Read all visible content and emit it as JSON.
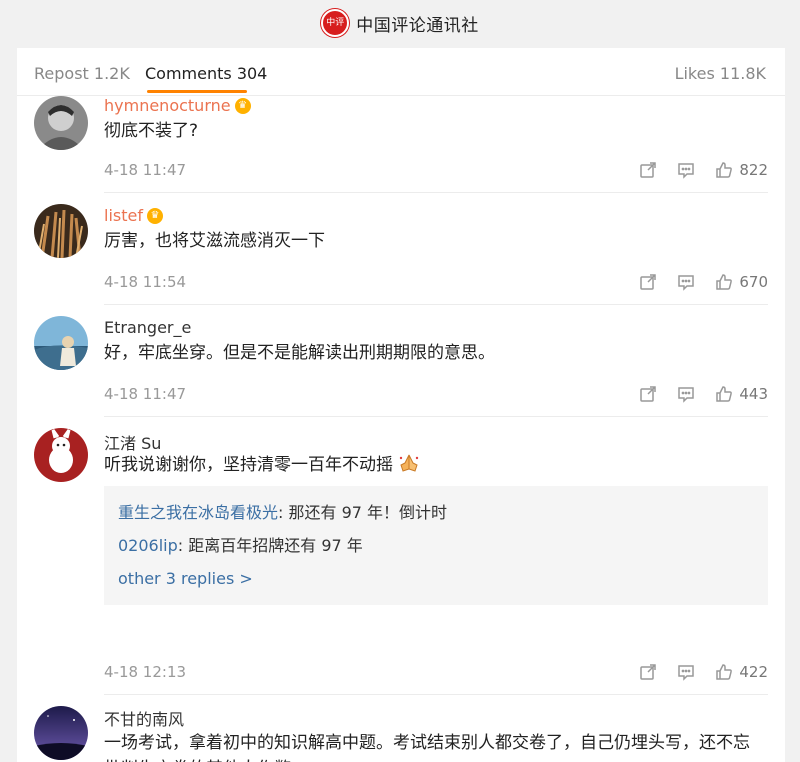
{
  "header": {
    "logo_text": "中评",
    "title": "中国评论通讯社"
  },
  "tabs": {
    "repost_label": "Repost 1.2K",
    "comments_label": "Comments 304",
    "likes_label": "Likes 11.8K",
    "active": "comments",
    "accent_color": "#ff8200"
  },
  "comments": [
    {
      "name": "hymnenocturne",
      "vip": true,
      "text": "彻底不装了?",
      "time": "4-18 11:47",
      "likes": "822"
    },
    {
      "name": "listef",
      "vip": true,
      "text": "厉害，也将艾滋流感消灭一下",
      "time": "4-18 11:54",
      "likes": "670"
    },
    {
      "name": "Etranger_e",
      "vip": false,
      "text": "好，牢底坐穿。但是不是能解读出刑期期限的意思。",
      "time": "4-18 11:47",
      "likes": "443"
    },
    {
      "name": "江渚 Su",
      "vip": false,
      "text": "听我说谢谢你，坚持清零一百年不动摇",
      "emoji": "praying-hands-icon",
      "time": "4-18 12:13",
      "likes": "422",
      "replies": [
        {
          "user": "重生之我在冰岛看极光",
          "text": ": 那还有 97 年！倒计时"
        },
        {
          "user": "0206lip",
          "text": ": 距离百年招牌还有 97 年"
        }
      ],
      "more_replies": "other 3 replies >"
    },
    {
      "name": "不甘的南风",
      "vip": false,
      "text": "一场考试，拿着初中的知识解高中题。考试结束别人都交卷了，自己仍埋头写，还不忘批判先交卷的其他人作弊。"
    }
  ],
  "colors": {
    "vip_name": "#eb7350",
    "reply_user": "#3b6fa4",
    "logo": "#d71e1e"
  }
}
